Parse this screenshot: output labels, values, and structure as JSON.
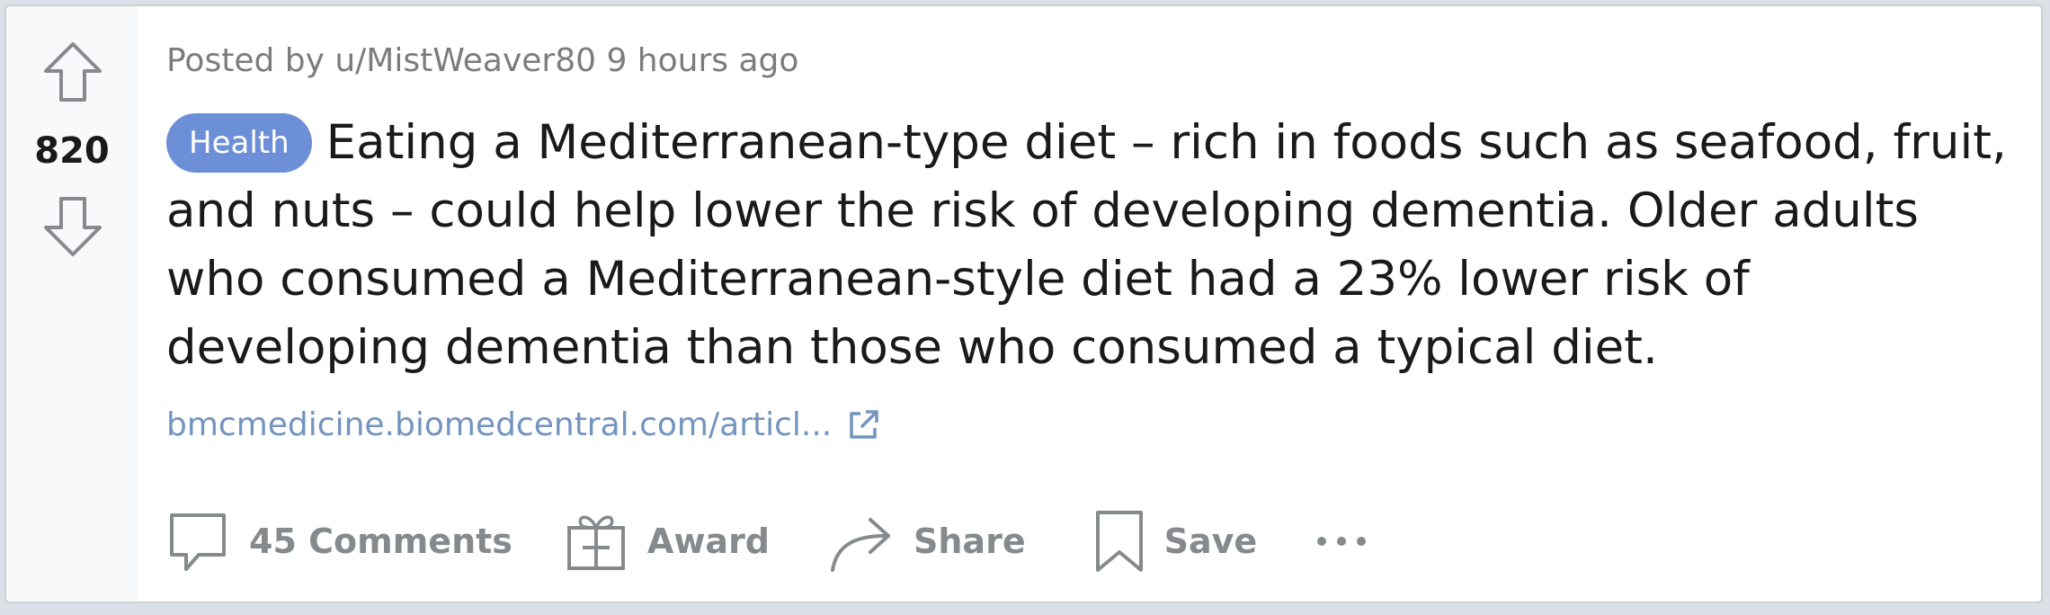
{
  "post": {
    "vote_count": "820",
    "meta": "Posted by u/MistWeaver80 9 hours ago",
    "flair": "Health",
    "title": "Eating a Mediterranean-type diet – rich in foods such as seafood, fruit, and nuts – could help lower the risk of developing dementia. Older adults who consumed a Mediterranean-style diet had a 23% lower risk of developing dementia than those who consumed a typical diet.",
    "link_text": "bmcmedicine.biomedcentral.com/articl..."
  },
  "actions": {
    "comments_label": "45 Comments",
    "award_label": "Award",
    "share_label": "Share",
    "save_label": "Save"
  },
  "colors": {
    "flair_bg": "#6c8fd7",
    "link": "#7294bf",
    "action_text": "#878a8c",
    "title_text": "#1a1a1b",
    "meta_text": "#7c7c7c"
  },
  "icons": {
    "upvote": "arrow-up-icon",
    "downvote": "arrow-down-icon",
    "external_link": "external-link-icon",
    "comments": "comment-bubble-icon",
    "award": "gift-icon",
    "share": "share-arrow-icon",
    "save": "bookmark-icon",
    "more": "more-horizontal-icon"
  }
}
